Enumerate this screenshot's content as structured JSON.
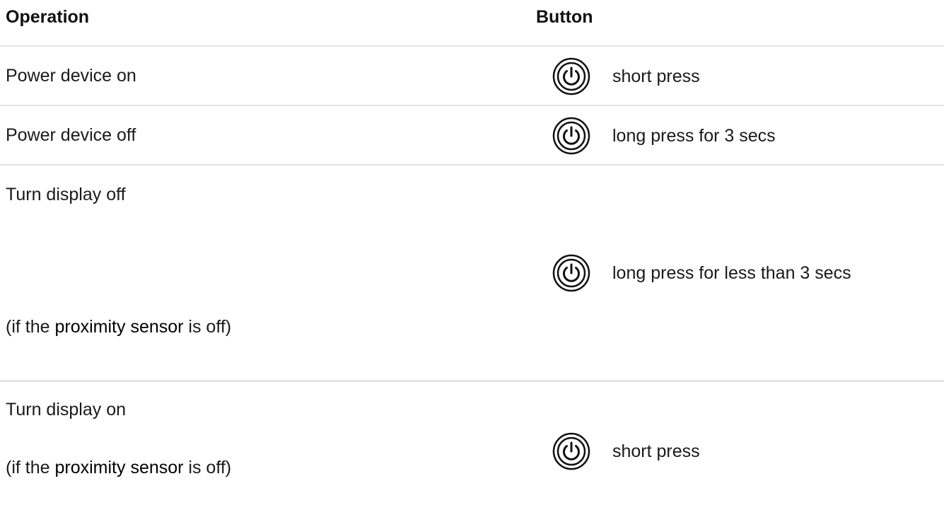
{
  "header": {
    "operation": "Operation",
    "button": "Button"
  },
  "rows": [
    {
      "operation": "Power device on",
      "button_icon": "power-button-icon",
      "action": "short press"
    },
    {
      "operation": "Power device off",
      "button_icon": "power-button-icon",
      "action": "long press for 3 secs"
    },
    {
      "operation": "Turn display off",
      "note_prefix": "(if the ",
      "note_link": "proximity sensor",
      "note_suffix": " is off)",
      "button_icon": "power-button-icon",
      "action": "long press for less than 3 secs"
    },
    {
      "operation": "Turn display on",
      "note_prefix": "(if the ",
      "note_link": "proximity sensor",
      "note_suffix": " is off)",
      "button_icon": "power-button-icon",
      "action": "short press"
    }
  ]
}
